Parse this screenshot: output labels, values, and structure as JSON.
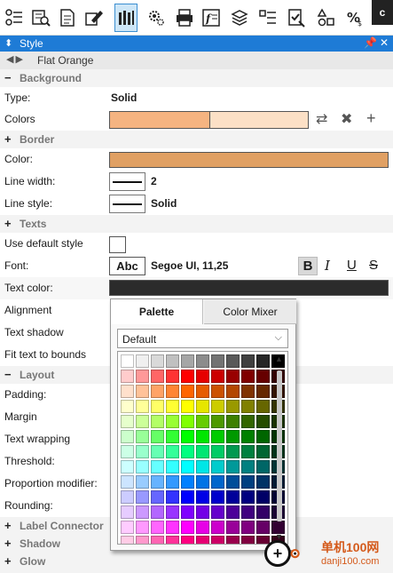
{
  "toolbar": {
    "icons": [
      "properties-icon",
      "inspector-icon",
      "document-icon",
      "edit-style-icon",
      "pencils-icon",
      "settings-icon",
      "printer-icon",
      "formula-icon",
      "layers-icon",
      "list-icon",
      "checklist-icon",
      "shapes-icon",
      "percent-icon",
      "app-icon"
    ],
    "active_index": 4,
    "app_label": "c"
  },
  "panel": {
    "title": "Style",
    "style_name": "Flat Orange"
  },
  "sections": {
    "background": "Background",
    "border": "Border",
    "texts": "Texts",
    "layout": "Layout",
    "label_connector": "Label Connector",
    "shadow": "Shadow",
    "glow": "Glow"
  },
  "fields": {
    "type_label": "Type:",
    "type_value": "Solid",
    "colors_label": "Colors",
    "border_color_label": "Color:",
    "line_width_label": "Line width:",
    "line_width_value": "2",
    "line_style_label": "Line style:",
    "line_style_value": "Solid",
    "use_default_style_label": "Use default style",
    "font_label": "Font:",
    "font_sample": "Abc",
    "font_value": "Segoe UI, 11,25",
    "bold_btn": "B",
    "italic_btn": "I",
    "underline_btn": "U",
    "strike_btn": "S",
    "text_color_label": "Text color:",
    "alignment_label": "Alignment",
    "text_shadow_label": "Text shadow",
    "fit_text_label": "Fit text to bounds",
    "padding_label": "Padding:",
    "margin_label": "Margin",
    "text_wrapping_label": "Text wrapping",
    "threshold_label": "Threshold:",
    "proportion_label": "Proportion modifier:",
    "rounding_label": "Rounding:"
  },
  "colors": {
    "background_color_1": "#f5b481",
    "background_color_2": "#fce0c6",
    "border_color": "#e0a063",
    "text_color": "#2b2b2b",
    "header_blue": "#1e7bd6"
  },
  "popup": {
    "tab_palette": "Palette",
    "tab_mixer": "Color Mixer",
    "dropdown_value": "Default",
    "palette_rows": [
      [
        "#ffffff",
        "#f0f0f0",
        "#d9d9d9",
        "#c0c0c0",
        "#a6a6a6",
        "#8c8c8c",
        "#737373",
        "#595959",
        "#404040",
        "#262626",
        "#000000"
      ],
      [
        "#ffcccc",
        "#ff9999",
        "#ff6666",
        "#ff3333",
        "#ff0000",
        "#e60000",
        "#cc0000",
        "#990000",
        "#800000",
        "#660000",
        "#330000"
      ],
      [
        "#ffe0cc",
        "#ffc299",
        "#ffa366",
        "#ff8533",
        "#ff6600",
        "#e65c00",
        "#cc5200",
        "#b34700",
        "#803300",
        "#662900",
        "#331400"
      ],
      [
        "#ffffcc",
        "#ffff99",
        "#ffff66",
        "#ffff33",
        "#ffff00",
        "#e6e600",
        "#cccc00",
        "#999900",
        "#808000",
        "#666600",
        "#333300"
      ],
      [
        "#e6ffcc",
        "#ccff99",
        "#b3ff66",
        "#99ff33",
        "#80ff00",
        "#66cc00",
        "#4d9900",
        "#3d8000",
        "#336600",
        "#264d00",
        "#1a3300"
      ],
      [
        "#ccffcc",
        "#99ff99",
        "#66ff66",
        "#33ff33",
        "#00ff00",
        "#00e600",
        "#00cc00",
        "#009900",
        "#008000",
        "#006600",
        "#003300"
      ],
      [
        "#ccffe6",
        "#99ffcc",
        "#66ffb3",
        "#33ff99",
        "#00ff80",
        "#00e673",
        "#00cc66",
        "#009950",
        "#008040",
        "#006633",
        "#00331a"
      ],
      [
        "#ccffff",
        "#99ffff",
        "#66ffff",
        "#33ffff",
        "#00ffff",
        "#00e6e6",
        "#00cccc",
        "#009999",
        "#008080",
        "#006666",
        "#003333"
      ],
      [
        "#cce5ff",
        "#99ccff",
        "#66b3ff",
        "#3399ff",
        "#0080ff",
        "#0073e6",
        "#0066cc",
        "#004d99",
        "#004080",
        "#003366",
        "#001a33"
      ],
      [
        "#ccccff",
        "#9999ff",
        "#6666ff",
        "#3333ff",
        "#0000ff",
        "#0000e6",
        "#0000cc",
        "#000099",
        "#000080",
        "#000066",
        "#000033"
      ],
      [
        "#e6ccff",
        "#cc99ff",
        "#b366ff",
        "#9933ff",
        "#8000ff",
        "#7300e6",
        "#6600cc",
        "#4d0099",
        "#400080",
        "#330066",
        "#1a0033"
      ],
      [
        "#ffccff",
        "#ff99ff",
        "#ff66ff",
        "#ff33ff",
        "#ff00ff",
        "#e600e6",
        "#cc00cc",
        "#990099",
        "#800080",
        "#660066",
        "#330033"
      ],
      [
        "#ffcce6",
        "#ff99cc",
        "#ff66b3",
        "#ff3399",
        "#ff0080",
        "#e60073",
        "#cc0066",
        "#99004d",
        "#800040",
        "#660033",
        "#33001a"
      ]
    ]
  },
  "watermark": {
    "line1": "单机100网",
    "line2": "danji100.com"
  }
}
